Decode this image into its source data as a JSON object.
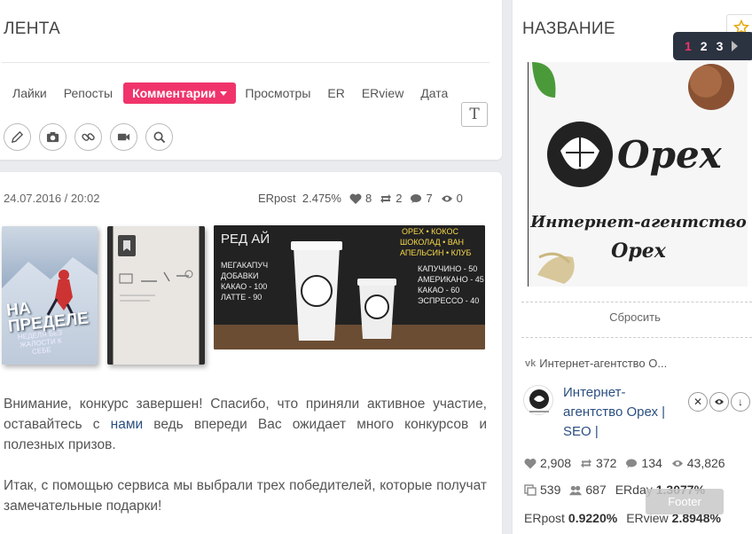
{
  "feed": {
    "title": "ЛЕНТА",
    "tabs": [
      "Лайки",
      "Репосты",
      "Комментарии",
      "Просмотры",
      "ER",
      "ERview",
      "Дата"
    ],
    "active_tab": "Комментарии",
    "text_button": "T"
  },
  "post": {
    "date": "24.07.2016 / 20:02",
    "erpost_label": "ERpost",
    "erpost_value": "2.475%",
    "likes": "8",
    "reposts": "2",
    "comments": "7",
    "views": "0",
    "text_part1": "Внимание, конкурс завершен! Спасибо, что приняли активное участие, оставайтесь с ",
    "text_link": "нами",
    "text_part2": " ведь впереди Вас ожидает много конкурсов и полезных призов.",
    "text_para2": "Итак, с помощью сервиса мы выбрали трех победителей, которые получат замечательные подарки!",
    "book1_title": "НА ПРЕДЕЛЕ",
    "book1_sub": "НЕДЕЛЯ БЕЗ ЖАЛОСТИ К СЕБЕ"
  },
  "sidebar": {
    "title": "НАЗВАНИЕ",
    "pager": [
      "1",
      "2",
      "3"
    ],
    "logo_brand": "Opex",
    "logo_line1": "Интернет-агентство",
    "logo_line2": "Орех",
    "reset": "Сбросить",
    "vk_name": "Интернет-агентство О...",
    "group_name": "Интернет-агентство Орех | SEO |",
    "stats": {
      "likes": "2,908",
      "reposts": "372",
      "comments": "134",
      "views": "43,826",
      "posts": "539",
      "members": "687",
      "erday_label": "ERday",
      "erday": "1.3077%",
      "erpost_label": "ERpost",
      "erpost": "0.9220%",
      "erview_label": "ERview",
      "erview": "2.8948%"
    },
    "footer": "Footer"
  },
  "colors": {
    "accent": "#f0346b",
    "link": "#2a4f80",
    "pager_bg": "#2b3240"
  }
}
